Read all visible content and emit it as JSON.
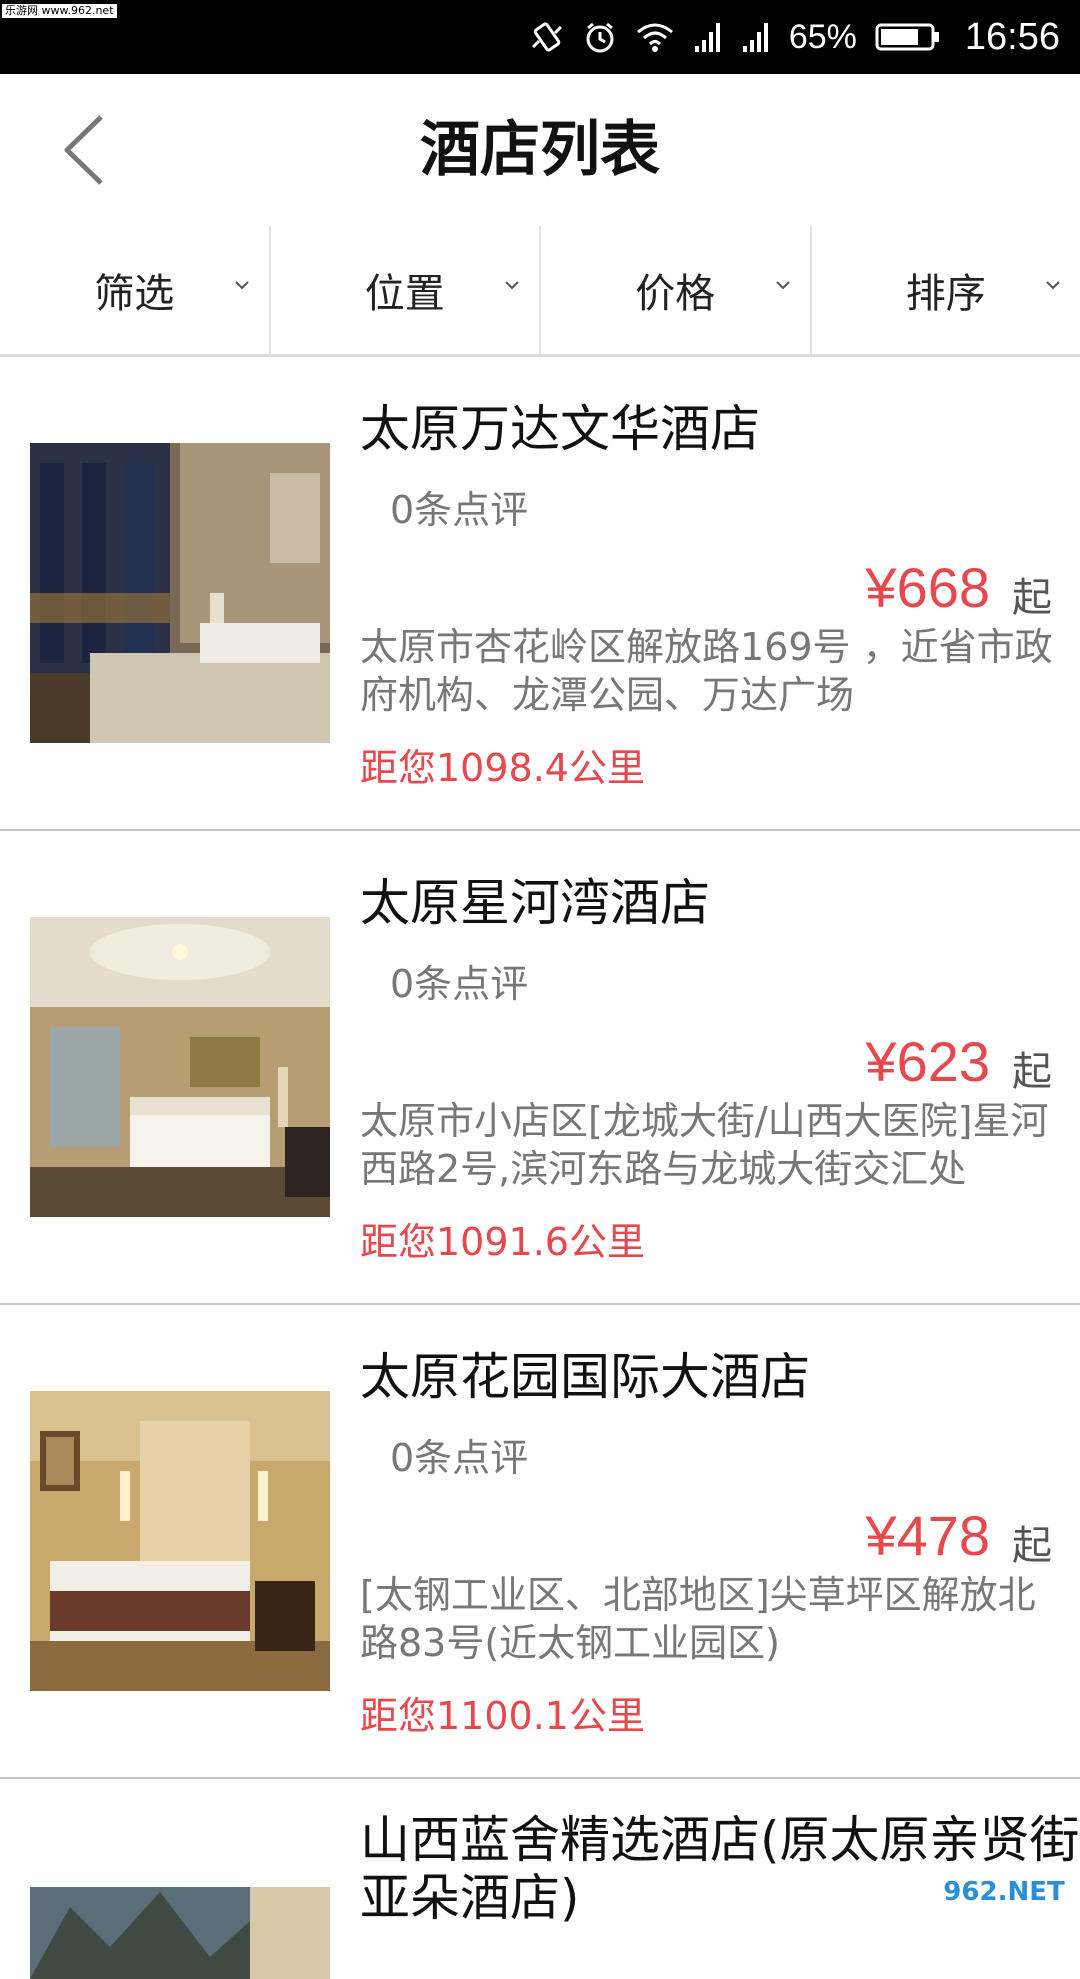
{
  "watermark_top": "乐游网 www.962.net",
  "status_bar": {
    "battery_percent": "65%",
    "time": "16:56"
  },
  "header": {
    "title": "酒店列表"
  },
  "filters": [
    {
      "label": "筛选"
    },
    {
      "label": "位置"
    },
    {
      "label": "价格"
    },
    {
      "label": "排序"
    }
  ],
  "hotels": [
    {
      "name": "太原万达文华酒店",
      "reviews": "0条点评",
      "price": "¥668",
      "price_suffix": "起",
      "address": "太原市杏花岭区解放路169号 ，近省市政府机构、龙潭公园、万达广场",
      "distance": "距您1098.4公里"
    },
    {
      "name": "太原星河湾酒店",
      "reviews": "0条点评",
      "price": "¥623",
      "price_suffix": "起",
      "address": "太原市小店区[龙城大街/山西大医院]星河西路2号,滨河东路与龙城大街交汇处",
      "distance": "距您1091.6公里"
    },
    {
      "name": "太原花园国际大酒店",
      "reviews": "0条点评",
      "price": "¥478",
      "price_suffix": "起",
      "address": "[太钢工业区、北部地区]尖草坪区解放北路83号(近太钢工业园区)",
      "distance": "距您1100.1公里"
    },
    {
      "name": "山西蓝舍精选酒店(原太原亲贤街亚朵酒店)"
    }
  ],
  "watermark_bottom": "962.NET",
  "colors": {
    "accent_red": "#e8474c",
    "text_gray": "#777777"
  },
  "icons": [
    "vibrate-icon",
    "alarm-icon",
    "wifi-icon",
    "signal-icon",
    "battery-icon",
    "back-chevron-icon",
    "dropdown-chevron-icon"
  ]
}
